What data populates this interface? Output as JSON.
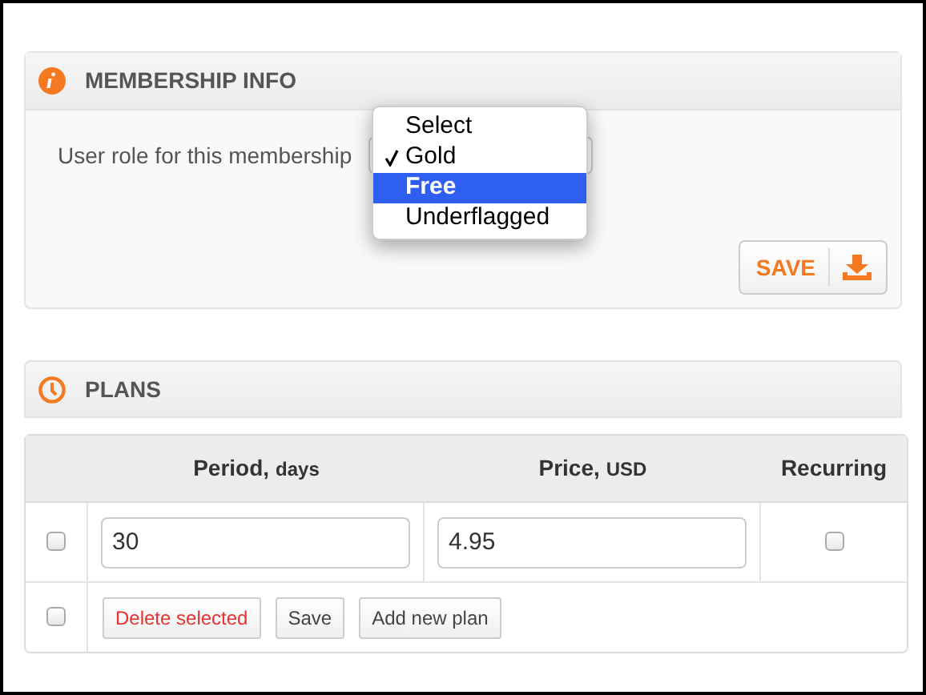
{
  "membership": {
    "title": "MEMBERSHIP INFO",
    "role_label": "User role for this membership",
    "role_menu": [
      {
        "label": "Select",
        "checked": false,
        "highlighted": false
      },
      {
        "label": "Gold",
        "checked": true,
        "highlighted": false
      },
      {
        "label": "Free",
        "checked": false,
        "highlighted": true
      },
      {
        "label": "Underflagged",
        "checked": false,
        "highlighted": false
      }
    ],
    "save_button": "SAVE"
  },
  "plans": {
    "title": "PLANS",
    "columns": [
      {
        "label": "Period,",
        "unit": "days"
      },
      {
        "label": "Price,",
        "unit": "USD"
      },
      {
        "label": "Recurring"
      }
    ],
    "rows": [
      {
        "checked": false,
        "period": "30",
        "price": "4.95",
        "recurring": false
      }
    ],
    "footer": {
      "checked": false,
      "buttons": [
        {
          "label": "Delete selected",
          "kind": "danger"
        },
        {
          "label": "Save",
          "kind": "normal"
        },
        {
          "label": "Add new plan",
          "kind": "normal"
        }
      ]
    }
  }
}
